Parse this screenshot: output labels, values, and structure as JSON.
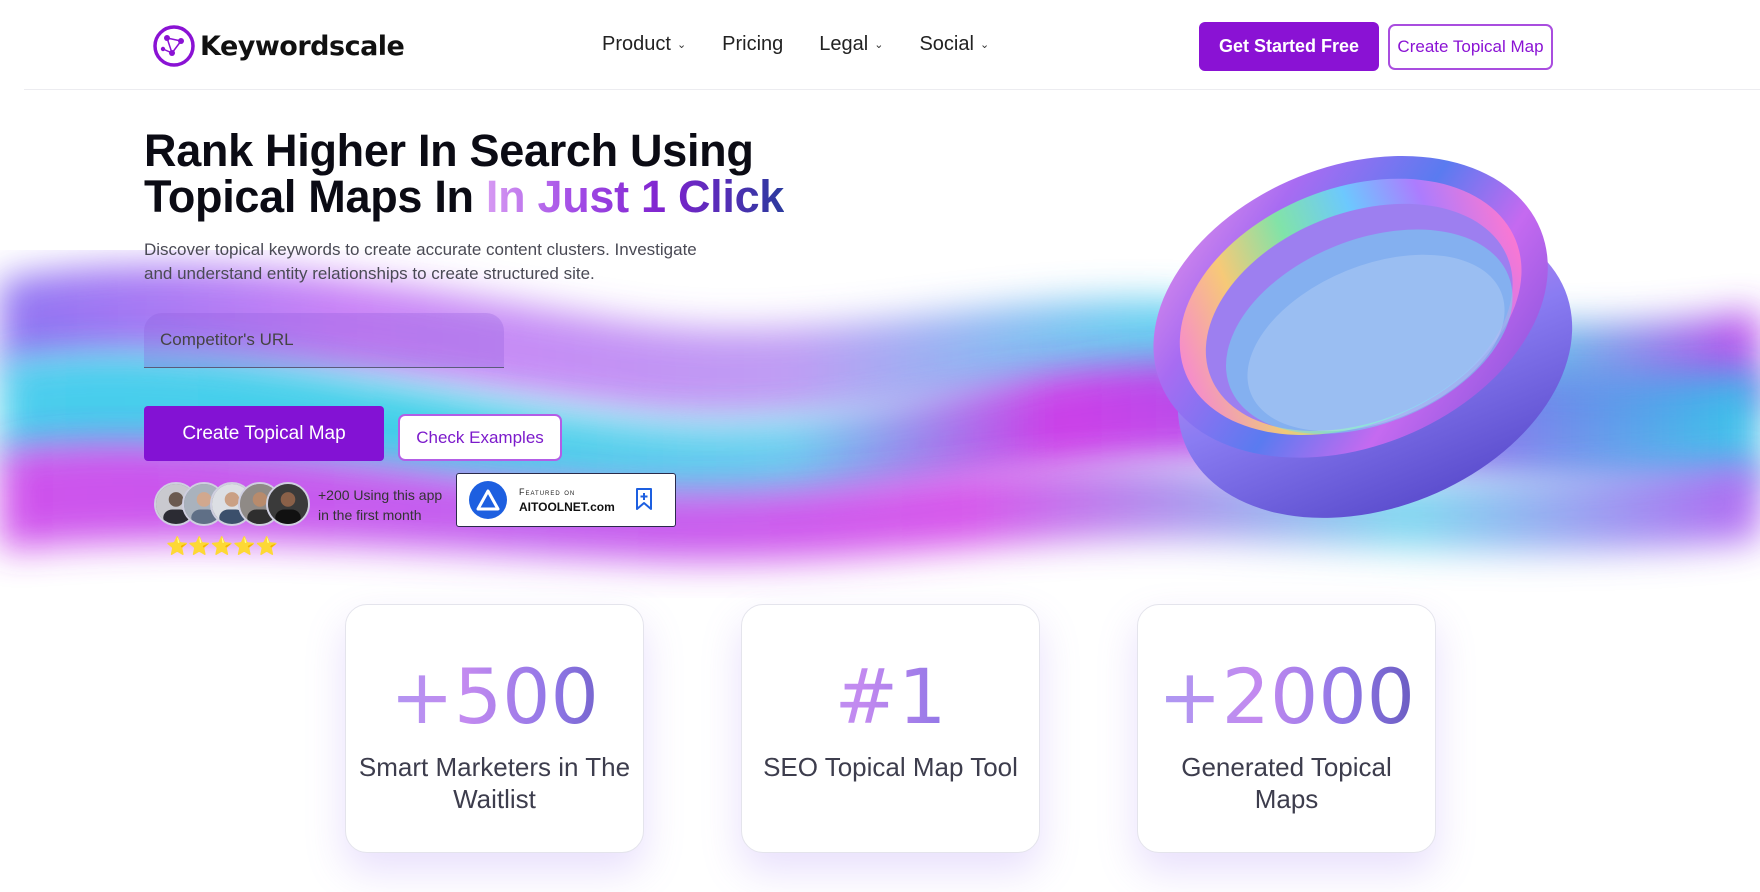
{
  "brand": {
    "name": "Keywordscale"
  },
  "nav": {
    "items": [
      {
        "label": "Product",
        "has_dropdown": true
      },
      {
        "label": "Pricing",
        "has_dropdown": false
      },
      {
        "label": "Legal",
        "has_dropdown": true
      },
      {
        "label": "Social",
        "has_dropdown": true
      }
    ],
    "cta_primary": "Get Started Free",
    "cta_secondary": "Create Topical Map"
  },
  "hero": {
    "headline_line1": "Rank Higher In Search Using",
    "headline_line2_plain": "Topical Maps In ",
    "headline_line2_highlight": "In Just 1 Click",
    "subtext": "Discover topical keywords to create accurate content clusters. Investigate and understand entity relationships to create structured site.",
    "url_placeholder": "Competitor's URL",
    "create_button": "Create Topical Map",
    "examples_button": "Check Examples",
    "proof_line1": "+200 Using this app",
    "proof_line2": "in the first month",
    "rating_stars": "⭐⭐⭐⭐⭐",
    "featured_top": "Featured on",
    "featured_main": "AITOOLNET.com"
  },
  "stats": [
    {
      "prefix": "+",
      "value": "500",
      "label": "Smart Marketers in The Waitlist"
    },
    {
      "prefix": "#",
      "value": "1",
      "label": "SEO Topical Map Tool"
    },
    {
      "prefix": "+",
      "value": "2000",
      "label": "Generated Topical Maps"
    }
  ],
  "colors": {
    "primary": "#8312d4",
    "accent": "#a94ddf",
    "text": "#0b0b14"
  }
}
